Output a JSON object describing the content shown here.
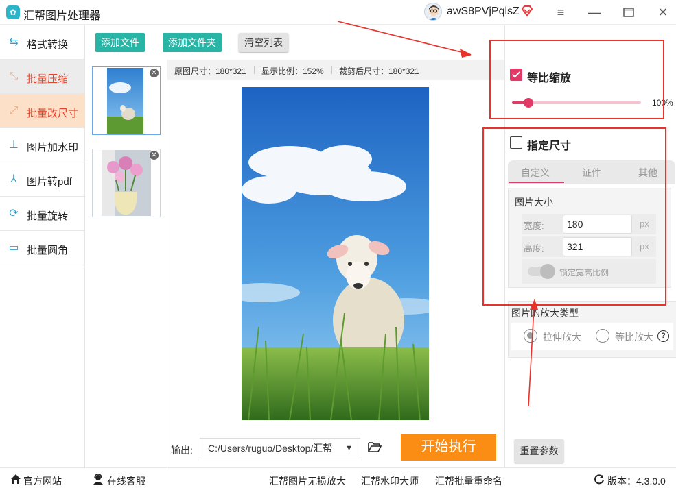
{
  "app": {
    "title": "汇帮图片处理器",
    "username": "awS8PVjPqlsZ"
  },
  "colors": {
    "accent": "#e13a66",
    "teal": "#29b5a6",
    "orange": "#fb8c14",
    "nav_highlight": "#fde0c8",
    "annotation_red": "#e8322c"
  },
  "sidebar": {
    "items": [
      {
        "label": "格式转换",
        "icon": "format-convert-icon"
      },
      {
        "label": "批量压缩",
        "icon": "compress-icon"
      },
      {
        "label": "批量改尺寸",
        "icon": "resize-icon"
      },
      {
        "label": "图片加水印",
        "icon": "watermark-icon"
      },
      {
        "label": "图片转pdf",
        "icon": "pdf-icon"
      },
      {
        "label": "批量旋转",
        "icon": "rotate-icon"
      },
      {
        "label": "批量圆角",
        "icon": "round-corner-icon"
      }
    ]
  },
  "toolbar": {
    "add_file": "添加文件",
    "add_folder": "添加文件夹",
    "clear_list": "清空列表"
  },
  "preview": {
    "original_size": "原图尺寸：180*321",
    "display_ratio": "显示比例：152%",
    "cropped_size": "裁剪后尺寸：180*321"
  },
  "output": {
    "label": "输出:",
    "path": "C:/Users/ruguo/Desktop/汇帮",
    "start_button": "开始执行"
  },
  "right_panel": {
    "proportional_label": "等比缩放",
    "proportional_checked": true,
    "scale_percent": 100,
    "scale_text": "100%",
    "specify_size_label": "指定尺寸",
    "specify_size_checked": false,
    "tabs": [
      "自定义",
      "证件",
      "其他"
    ],
    "active_tab": 0,
    "image_size_title": "图片大小",
    "width_label": "宽度:",
    "width_value": "180",
    "height_label": "高度:",
    "height_value": "321",
    "unit": "px",
    "lock_ratio_label": "锁定宽高比例",
    "zoom_type_title": "图片的放大类型",
    "zoom_options": [
      "拉伸放大",
      "等比放大"
    ],
    "zoom_selected": 0,
    "help": "?",
    "reset_button": "重置参数"
  },
  "footer": {
    "official_site": "官方网站",
    "online_service": "在线客服",
    "links": [
      "汇帮图片无损放大",
      "汇帮水印大师",
      "汇帮批量重命名"
    ],
    "version": "版本：4.3.0.0"
  }
}
